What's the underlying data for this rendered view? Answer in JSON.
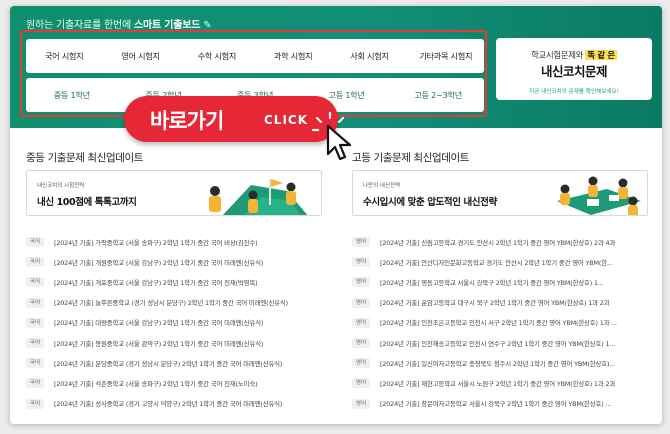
{
  "banner": {
    "title_prefix": "원하는 기출자료를 한번에 ",
    "title_bold": "스마트 기출보드",
    "pencil_icon": "pencil-icon",
    "exams": [
      "국어 시험지",
      "영어 시험지",
      "수학 시험지",
      "과학 시험지",
      "사회 시험지",
      "기타과목 시험지"
    ],
    "grades": [
      "중등 1학년",
      "중등 2학년",
      "중등 3학년",
      "고등 1학년",
      "고등 2~3학년"
    ],
    "go_label": "바로가기",
    "click_label": "CLICK"
  },
  "side": {
    "line1_prefix": "학교시험문제와 ",
    "line1_highlight": "똑 같 은",
    "line2": "내신코치문제",
    "line3": "지금 내신코치의 문제를 확인해보세요!"
  },
  "middle": {
    "section_title": "중등 기출문제 최신업데이트",
    "promo_small": "내신코치의 시험전략",
    "promo_big": "내신 100점에 톡톡고까지",
    "items": [
      {
        "tag": "국어",
        "text": "[2024년 기출] 가락중학교 (서울 송파구) 2학년 1학기 중간 국어 비상(김진수)"
      },
      {
        "tag": "국어",
        "text": "[2024년 기출] 개원중학교 (서울 강남구) 2학년 1학기 중간 국어 미래엔(신유식)"
      },
      {
        "tag": "국어",
        "text": "[2024년 기출] 개포중학교 (서울 강남구) 2학년 1학기 중간 국어 천재(박영목)"
      },
      {
        "tag": "국어",
        "text": "[2024년 기출] 늘푸른중학교 (경기 성남시 분당구) 2학년 1학기 중간 국어 미래엔(신유식)"
      },
      {
        "tag": "국어",
        "text": "[2024년 기출] 대왕중학교 (서울 강남구) 2학년 1학기 중간 국어 미래엔(신유식)"
      },
      {
        "tag": "국어",
        "text": "[2024년 기출] 봉원중학교 (서울 관악구) 2학년 1학기 중간 국어 미래엔(신유식)"
      },
      {
        "tag": "국어",
        "text": "[2024년 기출] 분당중학교 (경기 성남시 분당구) 2학년 1학기 중간 국어 미래엔(신유식)"
      },
      {
        "tag": "국어",
        "text": "[2024년 기출] 석촌중학교 (서울 송파구) 2학년 1학기 중간 국어 천재(노미숙)"
      },
      {
        "tag": "국어",
        "text": "[2024년 기출] 성사중학교 (경기 고양시 덕양구) 2학년 1학기 중간 국어 미래엔(신유식)"
      }
    ]
  },
  "high": {
    "section_title": "고등 기출문제 최신업데이트",
    "promo_small": "나만의 내신전략",
    "promo_big": "수시입시에 맞춘 압도적인 내신전략",
    "items": [
      {
        "tag": "영어",
        "text": "[2024년 기출] 신림고등학교 경기도 안산시 2학년 1학기 중간 영어 YBM(한상호) 2과 4과"
      },
      {
        "tag": "영어",
        "text": "[2024년 기출] 안산디자인문화고등학교 경기도 안산시 2학년 1학기 중간 영어 YBM(한..."
      },
      {
        "tag": "영어",
        "text": "[2024년 기출] 영동고등학교 서울시 강북구 2학년 1학기 중간 영어 YBM(한상호) 1..."
      },
      {
        "tag": "영어",
        "text": "[2024년 기출] 운암고등학교 대구시 북구 2학년 1학기 중간 영어 YBM(한상호) 1과 2과"
      },
      {
        "tag": "영어",
        "text": "[2024년 기출] 인천초은고등학교 인천시 서구 2학년 1학기 중간 영어 YBM(한상호) 1과 ..."
      },
      {
        "tag": "영어",
        "text": "[2024년 기출] 인천해송고등학교 인천시 연수구 2학년 1학기 중간 영어 YBM(한상호) 1..."
      },
      {
        "tag": "영어",
        "text": "[2024년 기출] 일신여자고등학교 충청북도 청주시 2학년 1학기 중간 영어 YBM(한상호)..."
      },
      {
        "tag": "영어",
        "text": "[2024년 기출] 재현고등학교 서울시 노원구 2학년 1학기 중간 영어 YBM(한상호) 1과 2과"
      },
      {
        "tag": "영어",
        "text": "[2024년 기출] 창문여자고등학교 서울시 강북구 2학년 1학기 중간 영어 YBM(한상호) ..."
      }
    ]
  }
}
